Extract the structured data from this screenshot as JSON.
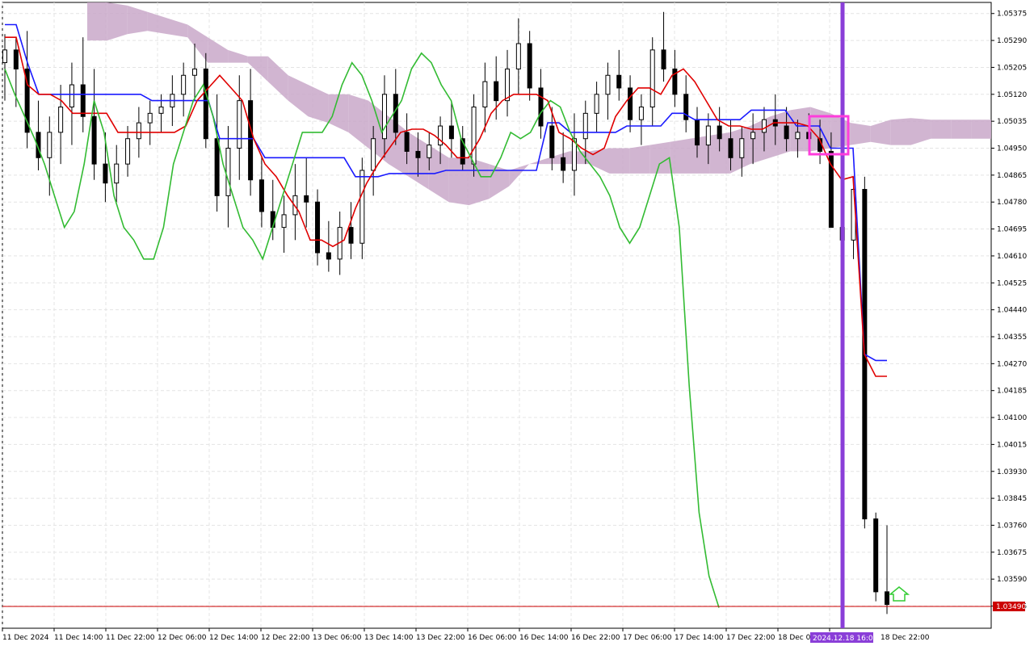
{
  "chart_data": {
    "type": "candlestick",
    "yticks": [
      "1.05375",
      "1.05290",
      "1.05205",
      "1.05120",
      "1.05035",
      "1.04950",
      "1.04865",
      "1.04780",
      "1.04695",
      "1.04610",
      "1.04525",
      "1.04440",
      "1.04355",
      "1.04270",
      "1.04185",
      "1.04100",
      "1.04015",
      "1.03930",
      "1.03845",
      "1.03760",
      "1.03675",
      "1.03590",
      "1.03505"
    ],
    "ylim": [
      1.03435,
      1.0541
    ],
    "xticks": [
      "11 Dec 2024",
      "11 Dec 14:00",
      "11 Dec 22:00",
      "12 Dec 06:00",
      "12 Dec 14:00",
      "12 Dec 22:00",
      "13 Dec 06:00",
      "13 Dec 14:00",
      "13 Dec 22:00",
      "16 Dec 06:00",
      "16 Dec 14:00",
      "16 Dec 22:00",
      "17 Dec 06:00",
      "17 Dec 14:00",
      "17 Dec 22:00",
      "18 Dec 06:00",
      "18 Dec 22:00"
    ],
    "highlighted_time": "2024.12.18 16:00",
    "current_price": "1.03490",
    "grid": true,
    "candles": [
      [
        1.0522,
        1.0531,
        1.051,
        1.0526
      ],
      [
        1.0526,
        1.053,
        1.0508,
        1.052
      ],
      [
        1.052,
        1.0532,
        1.0495,
        1.05
      ],
      [
        1.05,
        1.051,
        1.0488,
        1.0492
      ],
      [
        1.0492,
        1.0505,
        1.048,
        1.05
      ],
      [
        1.05,
        1.0515,
        1.049,
        1.0508
      ],
      [
        1.0508,
        1.0522,
        1.0496,
        1.0515
      ],
      [
        1.0515,
        1.053,
        1.05,
        1.0505
      ],
      [
        1.0505,
        1.052,
        1.0485,
        1.049
      ],
      [
        1.049,
        1.05,
        1.0478,
        1.0484
      ],
      [
        1.0484,
        1.0496,
        1.0478,
        1.049
      ],
      [
        1.049,
        1.0502,
        1.0486,
        1.0498
      ],
      [
        1.0498,
        1.0508,
        1.0492,
        1.0503
      ],
      [
        1.0503,
        1.051,
        1.0496,
        1.0506
      ],
      [
        1.0506,
        1.0512,
        1.05,
        1.0508
      ],
      [
        1.0508,
        1.0518,
        1.0502,
        1.0512
      ],
      [
        1.0512,
        1.0522,
        1.0505,
        1.0518
      ],
      [
        1.0518,
        1.0528,
        1.051,
        1.052
      ],
      [
        1.052,
        1.0525,
        1.0495,
        1.0498
      ],
      [
        1.0498,
        1.0512,
        1.0475,
        1.048
      ],
      [
        1.048,
        1.0502,
        1.047,
        1.0495
      ],
      [
        1.0495,
        1.0518,
        1.0485,
        1.051
      ],
      [
        1.051,
        1.052,
        1.048,
        1.0485
      ],
      [
        1.0485,
        1.0492,
        1.047,
        1.0475
      ],
      [
        1.0475,
        1.0485,
        1.0466,
        1.047
      ],
      [
        1.047,
        1.048,
        1.0462,
        1.0474
      ],
      [
        1.0474,
        1.049,
        1.0466,
        1.048
      ],
      [
        1.048,
        1.0492,
        1.047,
        1.0478
      ],
      [
        1.0478,
        1.0482,
        1.0458,
        1.0462
      ],
      [
        1.0462,
        1.0472,
        1.0456,
        1.046
      ],
      [
        1.046,
        1.0475,
        1.0455,
        1.047
      ],
      [
        1.047,
        1.0478,
        1.046,
        1.0465
      ],
      [
        1.0465,
        1.0492,
        1.046,
        1.0488
      ],
      [
        1.0488,
        1.0502,
        1.048,
        1.0498
      ],
      [
        1.0498,
        1.0518,
        1.0492,
        1.0512
      ],
      [
        1.0512,
        1.052,
        1.0496,
        1.05
      ],
      [
        1.05,
        1.0506,
        1.049,
        1.0494
      ],
      [
        1.0494,
        1.05,
        1.0486,
        1.0492
      ],
      [
        1.0492,
        1.05,
        1.0488,
        1.0496
      ],
      [
        1.0496,
        1.0505,
        1.049,
        1.0502
      ],
      [
        1.0502,
        1.051,
        1.0492,
        1.0498
      ],
      [
        1.0498,
        1.0502,
        1.0488,
        1.049
      ],
      [
        1.049,
        1.0512,
        1.0486,
        1.0508
      ],
      [
        1.0508,
        1.0522,
        1.05,
        1.0516
      ],
      [
        1.0516,
        1.0524,
        1.0504,
        1.051
      ],
      [
        1.051,
        1.0526,
        1.0505,
        1.052
      ],
      [
        1.052,
        1.0536,
        1.0512,
        1.0528
      ],
      [
        1.0528,
        1.0532,
        1.051,
        1.0514
      ],
      [
        1.0514,
        1.052,
        1.0498,
        1.0502
      ],
      [
        1.0502,
        1.0508,
        1.0488,
        1.0492
      ],
      [
        1.0492,
        1.05,
        1.0484,
        1.0488
      ],
      [
        1.0488,
        1.0506,
        1.048,
        1.0498
      ],
      [
        1.0498,
        1.051,
        1.049,
        1.0506
      ],
      [
        1.0506,
        1.0516,
        1.05,
        1.0512
      ],
      [
        1.0512,
        1.0522,
        1.0504,
        1.0518
      ],
      [
        1.0518,
        1.0526,
        1.051,
        1.0514
      ],
      [
        1.0514,
        1.0518,
        1.05,
        1.0504
      ],
      [
        1.0504,
        1.0512,
        1.0496,
        1.0508
      ],
      [
        1.0508,
        1.053,
        1.0502,
        1.0526
      ],
      [
        1.0526,
        1.0538,
        1.0516,
        1.052
      ],
      [
        1.052,
        1.0526,
        1.0508,
        1.0512
      ],
      [
        1.0512,
        1.0518,
        1.05,
        1.0504
      ],
      [
        1.0504,
        1.0508,
        1.0492,
        1.0496
      ],
      [
        1.0496,
        1.0506,
        1.049,
        1.0502
      ],
      [
        1.0502,
        1.0508,
        1.0494,
        1.0498
      ],
      [
        1.0498,
        1.0504,
        1.0488,
        1.0492
      ],
      [
        1.0492,
        1.0502,
        1.0486,
        1.0498
      ],
      [
        1.0498,
        1.0506,
        1.049,
        1.05
      ],
      [
        1.05,
        1.0508,
        1.0494,
        1.0504
      ],
      [
        1.0504,
        1.0512,
        1.0496,
        1.0502
      ],
      [
        1.0502,
        1.0508,
        1.0494,
        1.0498
      ],
      [
        1.0498,
        1.0504,
        1.0492,
        1.05
      ],
      [
        1.05,
        1.0506,
        1.0494,
        1.0498
      ],
      [
        1.0498,
        1.0504,
        1.049,
        1.0494
      ],
      [
        1.0494,
        1.05,
        1.0484,
        1.047
      ],
      [
        1.047,
        1.0478,
        1.046,
        1.0466
      ],
      [
        1.0466,
        1.0486,
        1.046,
        1.0482
      ],
      [
        1.0482,
        1.0486,
        1.0375,
        1.0378
      ],
      [
        1.0378,
        1.038,
        1.0352,
        1.0355
      ],
      [
        1.0355,
        1.0376,
        1.0348,
        1.0351
      ]
    ],
    "series": [
      {
        "color": "#1a1aff",
        "values": [
          1.0534,
          1.0534,
          1.0522,
          1.0512,
          1.0512,
          1.0512,
          1.0512,
          1.0512,
          1.0512,
          1.0512,
          1.0512,
          1.0512,
          1.0512,
          1.051,
          1.051,
          1.051,
          1.051,
          1.051,
          1.051,
          1.0498,
          1.0498,
          1.0498,
          1.0498,
          1.0492,
          1.0492,
          1.0492,
          1.0492,
          1.0492,
          1.0492,
          1.0492,
          1.0492,
          1.0486,
          1.0486,
          1.0486,
          1.0487,
          1.0487,
          1.0487,
          1.0487,
          1.0487,
          1.0488,
          1.0488,
          1.0488,
          1.0488,
          1.0488,
          1.0488,
          1.0488,
          1.0488,
          1.0488,
          1.0503,
          1.0503,
          1.05,
          1.05,
          1.05,
          1.05,
          1.05,
          1.0502,
          1.0502,
          1.0502,
          1.0502,
          1.0506,
          1.0506,
          1.0504,
          1.0504,
          1.0504,
          1.0504,
          1.0504,
          1.0507,
          1.0507,
          1.0507,
          1.0507,
          1.0502,
          1.0502,
          1.0502,
          1.0495,
          1.0495,
          1.0495,
          1.043,
          1.0428,
          1.0428
        ]
      },
      {
        "color": "#e00000",
        "values": [
          1.053,
          1.053,
          1.0515,
          1.0512,
          1.0512,
          1.051,
          1.0506,
          1.0506,
          1.0506,
          1.0506,
          1.05,
          1.05,
          1.05,
          1.05,
          1.05,
          1.05,
          1.0502,
          1.051,
          1.0514,
          1.0518,
          1.0514,
          1.051,
          1.0498,
          1.049,
          1.0486,
          1.048,
          1.0475,
          1.0466,
          1.0466,
          1.0464,
          1.0466,
          1.0476,
          1.0484,
          1.049,
          1.0495,
          1.05,
          1.0501,
          1.0501,
          1.0499,
          1.0496,
          1.0492,
          1.0492,
          1.0498,
          1.0506,
          1.051,
          1.0512,
          1.0512,
          1.0512,
          1.051,
          1.05,
          1.0498,
          1.0495,
          1.0493,
          1.0495,
          1.0505,
          1.051,
          1.0514,
          1.0514,
          1.0512,
          1.0518,
          1.052,
          1.0516,
          1.051,
          1.0504,
          1.0502,
          1.0502,
          1.0501,
          1.0501,
          1.0503,
          1.0503,
          1.0503,
          1.0502,
          1.0498,
          1.049,
          1.0485,
          1.0486,
          1.043,
          1.0423,
          1.0423
        ]
      },
      {
        "color": "#33bb33",
        "values": [
          1.052,
          1.0512,
          1.0505,
          1.0498,
          1.049,
          1.048,
          1.047,
          1.0475,
          1.049,
          1.051,
          1.05,
          1.048,
          1.047,
          1.0466,
          1.046,
          1.046,
          1.047,
          1.049,
          1.05,
          1.051,
          1.0515,
          1.0505,
          1.049,
          1.048,
          1.047,
          1.0466,
          1.046,
          1.047,
          1.048,
          1.049,
          1.05,
          1.05,
          1.05,
          1.0505,
          1.0515,
          1.0522,
          1.0518,
          1.051,
          1.05,
          1.0505,
          1.051,
          1.052,
          1.0525,
          1.0522,
          1.0515,
          1.051,
          1.0498,
          1.0492,
          1.0486,
          1.0486,
          1.0492,
          1.05,
          1.0498,
          1.05,
          1.0506,
          1.051,
          1.0508,
          1.05,
          1.0494,
          1.049,
          1.0486,
          1.048,
          1.047,
          1.0465,
          1.047,
          1.048,
          1.049,
          1.0492,
          1.047,
          1.042,
          1.038,
          1.036,
          1.035
        ]
      }
    ],
    "cloud": {
      "senkou_a": [
        1.0541,
        1.0541,
        1.054,
        1.0538,
        1.0536,
        1.0534,
        1.053,
        1.0526,
        1.0524,
        1.0524,
        1.0518,
        1.0515,
        1.0512,
        1.0512,
        1.051,
        1.0505,
        1.05,
        1.0496,
        1.0492,
        1.0492,
        1.049,
        1.0488,
        1.049,
        1.0492,
        1.0494,
        1.0494,
        1.0495,
        1.0495,
        1.0496,
        1.0497,
        1.0498,
        1.0499,
        1.05,
        1.0502,
        1.0505,
        1.0507,
        1.0508,
        1.0506,
        1.0503,
        1.0502,
        1.0504,
        1.05045,
        1.0504,
        1.0504,
        1.0504,
        1.0504
      ],
      "senkou_b": [
        1.0529,
        1.0529,
        1.0531,
        1.0532,
        1.0531,
        1.053,
        1.0522,
        1.0522,
        1.0522,
        1.0516,
        1.051,
        1.0505,
        1.0503,
        1.05,
        1.0495,
        1.049,
        1.0486,
        1.0482,
        1.0478,
        1.0477,
        1.0479,
        1.0483,
        1.049,
        1.049,
        1.049,
        1.049,
        1.0487,
        1.0487,
        1.0487,
        1.0487,
        1.0487,
        1.0487,
        1.0487,
        1.049,
        1.0492,
        1.0494,
        1.0494,
        1.0495,
        1.0496,
        1.0497,
        1.0496,
        1.0496,
        1.0498,
        1.0498,
        1.0498,
        1.0498
      ]
    }
  }
}
